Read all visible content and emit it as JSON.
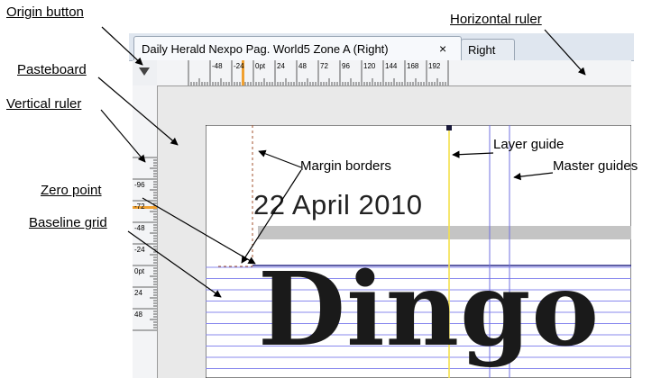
{
  "tabs": [
    {
      "title": "Daily Herald Nexpo Pag. World5 Zone A (Right)",
      "close": "×"
    },
    {
      "title": "Right"
    }
  ],
  "rulers": {
    "horizontal": [
      "-48",
      "-24",
      "0pt",
      "24",
      "48",
      "72",
      "96",
      "120",
      "144",
      "168",
      "192"
    ],
    "vertical": [
      "-96",
      "-72",
      "-48",
      "-24",
      "0pt",
      "24",
      "48"
    ]
  },
  "page": {
    "date": "22 April  2010",
    "headline": "Dingo"
  },
  "callouts": [
    {
      "id": "origin-button",
      "text": "Origin button"
    },
    {
      "id": "horizontal-ruler",
      "text": "Horizontal ruler"
    },
    {
      "id": "pasteboard",
      "text": "Pasteboard"
    },
    {
      "id": "vertical-ruler",
      "text": "Vertical ruler"
    },
    {
      "id": "margin-borders",
      "text": "Margin borders"
    },
    {
      "id": "layer-guide",
      "text": "Layer guide"
    },
    {
      "id": "master-guides",
      "text": "Master guides"
    },
    {
      "id": "zero-point",
      "text": "Zero point"
    },
    {
      "id": "baseline-grid",
      "text": "Baseline grid"
    }
  ],
  "colors": {
    "ruler_marker": "#f0a030",
    "layer_guide": "#f4e04a",
    "master_guide": "#7070e0",
    "baseline": "#8888ee",
    "margin": "#a0522d"
  }
}
